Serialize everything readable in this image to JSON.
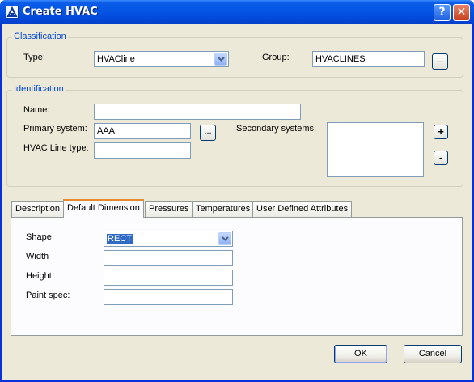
{
  "window": {
    "title": "Create HVAC",
    "help_label": "?",
    "close_label": "✕"
  },
  "classification": {
    "title": "Classification",
    "type_label": "Type:",
    "type_value": "HVACline",
    "group_label": "Group:",
    "group_value": "HVACLINES",
    "browse_label": "..."
  },
  "identification": {
    "title": "Identification",
    "name_label": "Name:",
    "name_value": "",
    "primary_label": "Primary system:",
    "primary_value": "AAA",
    "browse_label": "...",
    "secondary_label": "Secondary systems:",
    "line_type_label": "HVAC Line type:",
    "line_type_value": "",
    "add_label": "+",
    "remove_label": "-"
  },
  "tabs": [
    {
      "label": "Description"
    },
    {
      "label": "Default Dimension"
    },
    {
      "label": "Pressures"
    },
    {
      "label": "Temperatures"
    },
    {
      "label": "User Defined Attributes"
    }
  ],
  "dimension": {
    "shape_label": "Shape",
    "shape_value": "RECT",
    "width_label": "Width",
    "width_value": "",
    "height_label": "Height",
    "height_value": "",
    "paint_label": "Paint spec:",
    "paint_value": ""
  },
  "buttons": {
    "ok": "OK",
    "cancel": "Cancel"
  },
  "colors": {
    "title_bar": "#0554e3",
    "group_title": "#0046d5",
    "tab_highlight": "#e68b2c",
    "face": "#ece9d8"
  }
}
